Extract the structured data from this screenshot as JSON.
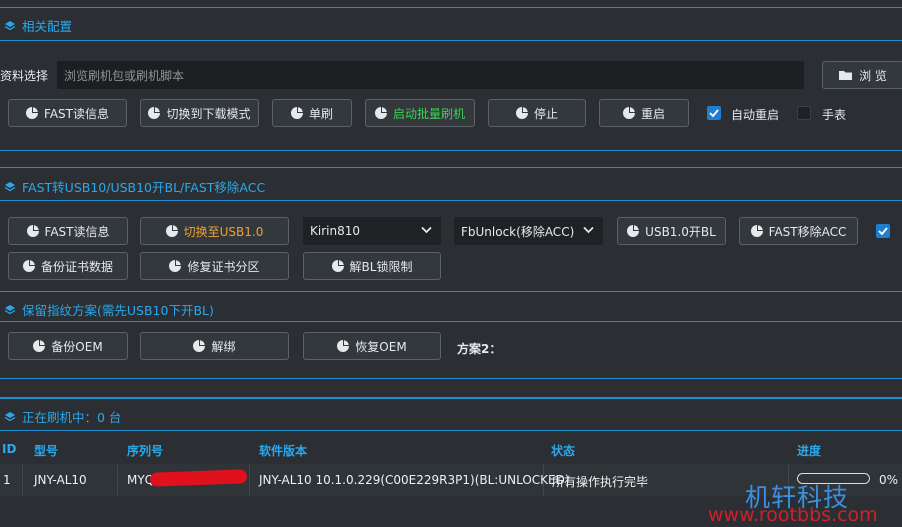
{
  "colors": {
    "accent": "#2aa8ec",
    "background": "#2b2f33",
    "button_bg": "#33383c",
    "green_text": "#39d353",
    "orange_text": "#f0a030",
    "checkbox_checked": "#1e7fd0"
  },
  "section1": {
    "title": "相关配置",
    "source_label": "资料选择",
    "source_placeholder": "浏览刷机包或刷机脚本",
    "browse_label": "浏 览",
    "buttons": [
      "FAST读信息",
      "切换到下载模式",
      "单刷",
      "启动批量刷机",
      "停止",
      "重启"
    ],
    "auto_restart_label": "自动重启",
    "auto_restart_checked": true,
    "watch_label": "手表",
    "watch_checked": false
  },
  "section2": {
    "title": "FAST转USB10/USB10开BL/FAST移除ACC",
    "buttons_row1": [
      "FAST读信息",
      "切换至USB1.0"
    ],
    "chip_select": "Kirin810",
    "mode_select": "FbUnlock(移除ACC)",
    "buttons_row1b": [
      "USB1.0开BL",
      "FAST移除ACC"
    ],
    "buttons_row2": [
      "备份证书数据",
      "修复证书分区",
      "解BL锁限制"
    ],
    "right_checkbox_checked": true
  },
  "section3": {
    "title": "保留指纹方案(需先USB10下开BL)",
    "buttons": [
      "备份OEM",
      "解绑",
      "恢复OEM"
    ],
    "plan_label": "方案2："
  },
  "section4": {
    "title": "正在刷机中：0 台",
    "columns": [
      "ID",
      "型号",
      "序列号",
      "软件版本",
      "状态",
      "进度"
    ],
    "rows": [
      {
        "id": "1",
        "model": "JNY-AL10",
        "serial": "MYQ",
        "version": "JNY-AL10 10.1.0.229(C00E229R3P1)(BL:UNLOCKED)",
        "status": "所有操作执行完毕",
        "progress": 0,
        "progress_text": "0%"
      }
    ]
  },
  "watermark": {
    "title": "机轩科技",
    "url": "www.rootbbs.com"
  }
}
